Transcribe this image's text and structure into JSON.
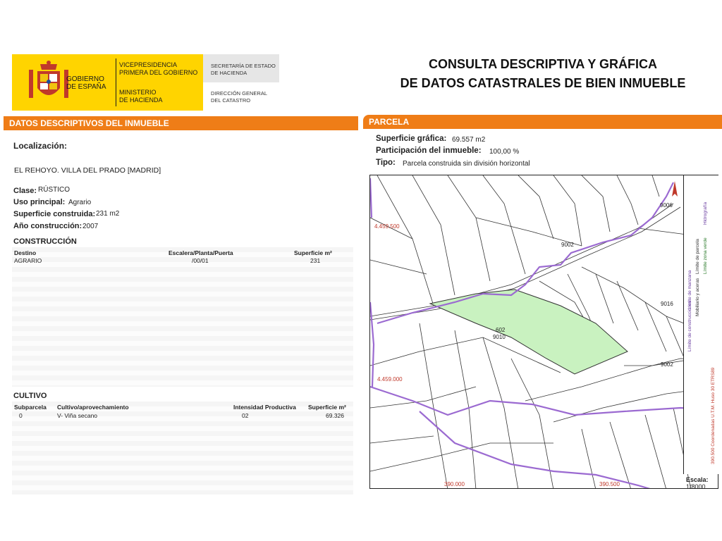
{
  "header": {
    "gov_line1": "GOBIERNO",
    "gov_line2": "DE ESPAÑA",
    "vice_line1": "VICEPRESIDENCIA",
    "vice_line2": "PRIMERA DEL GOBIERNO",
    "min_line1": "MINISTERIO",
    "min_line2": "DE HACIENDA",
    "sec_line1": "SECRETARÍA DE ESTADO",
    "sec_line2": "DE HACIENDA",
    "dir_line1": "DIRECCIÓN GENERAL",
    "dir_line2": "DEL CATASTRO",
    "title_line1": "CONSULTA DESCRIPTIVA Y GRÁFICA",
    "title_line2": "DE DATOS CATASTRALES DE BIEN INMUEBLE"
  },
  "left": {
    "bar": "DATOS DESCRIPTIVOS DEL INMUEBLE",
    "localizacion_label": "Localización:",
    "localizacion_value": "EL REHOYO. VILLA DEL PRADO [MADRID]",
    "clase_label": "Clase:",
    "clase_value": "RÚSTICO",
    "uso_label": "Uso principal:",
    "uso_value": "Agrario",
    "superficie_label": "Superficie construida:",
    "superficie_value": "231 m2",
    "anio_label": "Año construcción:",
    "anio_value": "2007"
  },
  "construccion": {
    "title": "CONSTRUCCIÓN",
    "headers": [
      "Destino",
      "Escalera/Planta/Puerta",
      "Superficie m²"
    ],
    "rows": [
      [
        "AGRARIO",
        "/00/01",
        "231"
      ]
    ]
  },
  "cultivo": {
    "title": "CULTIVO",
    "headers": [
      "Subparcela",
      "Cultivo/aprovechamiento",
      "Intensidad Productiva",
      "Superficie m²"
    ],
    "rows": [
      [
        "0",
        "V- Viña secano",
        "02",
        "69.326"
      ]
    ]
  },
  "parcela": {
    "bar": "PARCELA",
    "superficie_label": "Superficie gráfica:",
    "superficie_value": "69.557 m2",
    "participacion_label": "Participación del inmueble:",
    "participacion_value": "100,00 %",
    "tipo_label": "Tipo:",
    "tipo_value": "Parcela construida sin división horizontal"
  },
  "map": {
    "coord_y_top": "4.459.500",
    "coord_y_bottom": "4.459.000",
    "coord_x_left": "390.000",
    "coord_x_right": "390.500",
    "label_9002_top": "9002",
    "label_9016": "9016",
    "label_9002_right": "9002",
    "label_9006": "9006",
    "label_602": "602",
    "label_9010": "9010",
    "escala_label": "Escala:",
    "escala_value": "1/8000",
    "legend_1": "Límite de manzana",
    "legend_2": "Límite de parcela",
    "legend_3": "Hidrografía",
    "legend_4": "Límite de construcciones",
    "legend_5": "Mobiliario y aceras",
    "legend_6": "Límite zona verde",
    "legend_coords": "390.500 Coordenadas U.T.M. Huso 30 ETRS89",
    "colors": {
      "parcel_fill": "#c9f2c0",
      "hydro": "#9b6ad1",
      "coord_text": "#c0392b"
    }
  }
}
